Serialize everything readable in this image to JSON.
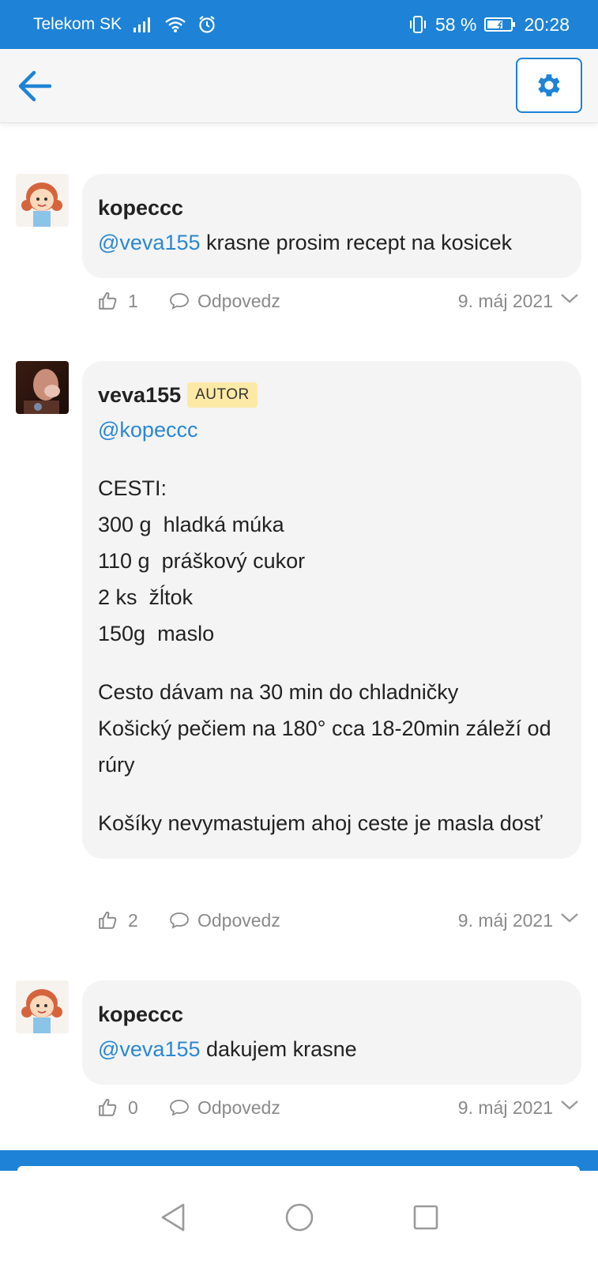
{
  "status_bar": {
    "carrier": "Telekom SK",
    "battery_percent": "58 %",
    "time": "20:28"
  },
  "app_bar": {
    "back_icon": "arrow-left-icon",
    "settings_icon": "gear-icon"
  },
  "comments": [
    {
      "author": "kopeccc",
      "badge": "",
      "avatar": "cartoon-girl-avatar",
      "mention": "@veva155",
      "text": "krasne prosim recept na kosicek",
      "likes": "1",
      "reply_label": "Odpovedz",
      "date": "9. máj 2021"
    },
    {
      "author": "veva155",
      "badge": "AUTOR",
      "avatar": "photo-avatar",
      "mention": "@kopeccc",
      "paragraphs": [
        [
          "CESTI:",
          "300 g  hladká múka",
          "110 g  práškový cukor",
          "2 ks  žĺtok",
          "150g  maslo"
        ],
        [
          "Cesto dávam na 30 min do chladničky",
          "Košický pečiem na 180° cca 18-20min záleží od rúry"
        ],
        [
          "Košíky nevymastujem ahoj ceste je masla dosť"
        ]
      ],
      "likes": "2",
      "reply_label": "Odpovedz",
      "date": "9. máj 2021"
    },
    {
      "author": "kopeccc",
      "badge": "",
      "avatar": "cartoon-girl-avatar",
      "mention": "@veva155",
      "text": "dakujem krasne",
      "likes": "0",
      "reply_label": "Odpovedz",
      "date": "9. máj 2021"
    }
  ],
  "nav_bar": {
    "back_icon": "triangle-back-icon",
    "home_icon": "circle-home-icon",
    "recents_icon": "square-recents-icon"
  },
  "colors": {
    "accent": "#1e83d6",
    "mention": "#2a88d2",
    "bubble": "#f4f4f4",
    "badge": "#fde9a6"
  }
}
